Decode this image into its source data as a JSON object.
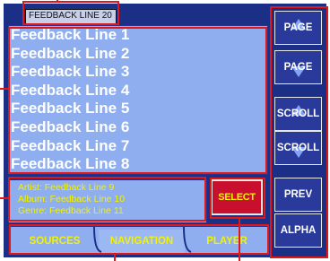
{
  "title_tab": "FEEDBACK LINE 20",
  "feedback_lines": [
    "Feedback Line 1",
    "Feedback Line 2",
    "Feedback Line 3",
    "Feedback Line 4",
    "Feedback Line 5",
    "Feedback Line 6",
    "Feedback Line 7",
    "Feedback Line 8"
  ],
  "info": {
    "artist": "Artist:  Feedback Line 9",
    "album": "Album:  Feedback Line 10",
    "genre": "Genre:  Feedback Line 11"
  },
  "select_label": "SELECT",
  "tabs": [
    "SOURCES",
    "NAVIGATION",
    "PLAYER"
  ],
  "active_tab": "NAVIGATION",
  "side_buttons": [
    "PAGE",
    "PAGE",
    "SCROLL",
    "SCROLL",
    "PREV",
    "ALPHA"
  ],
  "colors": {
    "background": "#1b2f86",
    "panel": "#8faeef",
    "text_white": "#ffffff",
    "text_yellow": "#f2f200",
    "select_red": "#c8102e",
    "annotation_red": "#e01818"
  }
}
